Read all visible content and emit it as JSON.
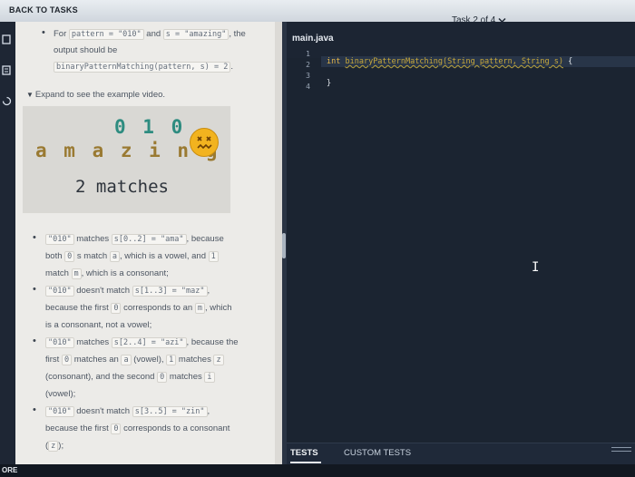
{
  "header": {
    "back_label": "BACK TO TASKS",
    "task_label": "Task 2 of 4",
    "task_chevron_icon": "chevron-down-icon"
  },
  "sidebar": {
    "icons": [
      "document-icon",
      "list-icon",
      "refresh-icon"
    ]
  },
  "description": {
    "intro": {
      "for": "For",
      "pattern_code": "pattern = \"010\"",
      "and": "and",
      "s_code": "s = \"amazing\"",
      "the": ", the",
      "output_line": "output should be",
      "call_code": "binaryPatternMatching(pattern, s) = 2",
      "period": "."
    },
    "expand_label": "Expand to see the example video.",
    "video": {
      "pattern": "0 1 0",
      "word": "a m a z i n g",
      "matches": "2 matches",
      "emoji_icon": "dizzy-face-icon"
    },
    "examples": [
      {
        "a": "\"010\"",
        "b": "matches",
        "c": "s[0..2] = \"ama\"",
        "d": ", because",
        "e": "both",
        "f": "0",
        "g": "s match",
        "h": "a",
        "i": ", which is a vowel, and",
        "j": "1",
        "k": "match",
        "l": "m",
        "m": ", which is a consonant;"
      },
      {
        "a": "\"010\"",
        "b": "doesn't match",
        "c": "s[1..3] = \"maz\"",
        "d": ",",
        "e": "because the first",
        "f": "0",
        "g": "corresponds to an",
        "h": "m",
        "i": ", which",
        "j": "is a consonant, not a vowel;"
      },
      {
        "a": "\"010\"",
        "b": "matches",
        "c": "s[2..4] = \"azi\"",
        "d": ", because the",
        "e": "first",
        "f": "0",
        "g": "matches an",
        "h": "a",
        "i": "(vowel),",
        "j": "1",
        "k": "matches",
        "l": "z",
        "m": "(consonant), and the second",
        "n": "0",
        "o": "matches",
        "p": "i",
        "q": "(vowel);"
      },
      {
        "a": "\"010\"",
        "b": "doesn't match",
        "c": "s[3..5] = \"zin\"",
        "d": ",",
        "e": "because the first",
        "f": "0",
        "g": "corresponds to a consonant",
        "h": "z",
        "i": ");"
      }
    ]
  },
  "editor": {
    "file_name": "main.java",
    "line_numbers": [
      "1",
      "2",
      "3",
      "4"
    ],
    "code": {
      "kw": "int",
      "fn": "binaryPatternMatching(String pattern, String s)",
      "open": "{",
      "close": "}"
    }
  },
  "bottom_tabs": {
    "tests": "TESTS",
    "custom": "CUSTOM TESTS"
  },
  "footer": {
    "more": "ORE"
  }
}
